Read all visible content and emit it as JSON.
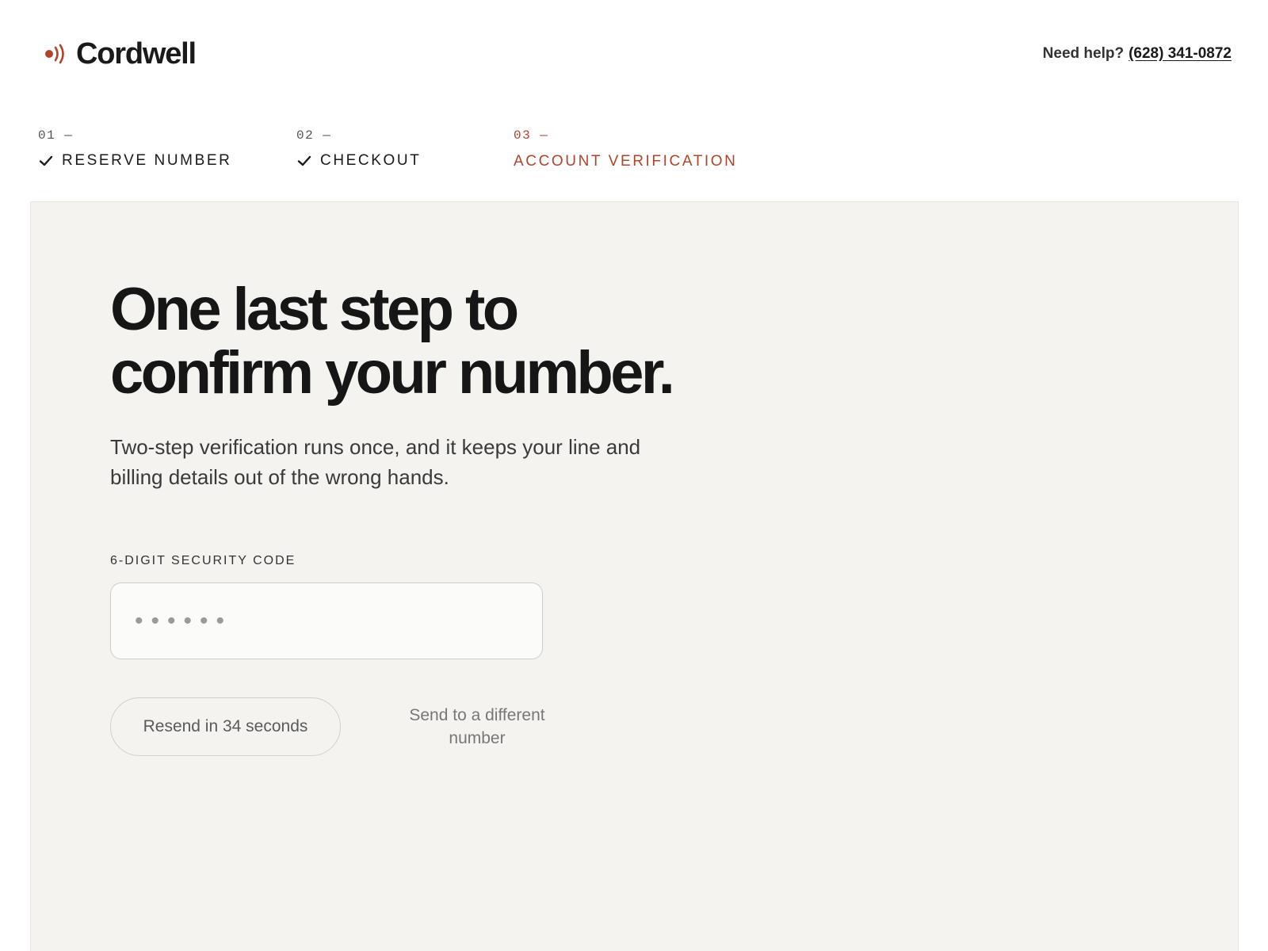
{
  "brand": {
    "name": "Cordwell",
    "logo_icon": "sound-waves-icon",
    "accent_color": "#b0442a"
  },
  "header": {
    "help_label": "Need help?",
    "help_phone": "(628) 341-0872"
  },
  "steps": [
    {
      "number": "01 —",
      "label": "RESERVE NUMBER",
      "status": "complete",
      "icon": "check-icon"
    },
    {
      "number": "02 —",
      "label": "CHECKOUT",
      "status": "complete",
      "icon": "check-icon"
    },
    {
      "number": "03 —",
      "label": "ACCOUNT VERIFICATION",
      "status": "active"
    }
  ],
  "main": {
    "headline_line1": "One last step to",
    "headline_line2": "confirm your number.",
    "subtitle": "Two-step verification runs once, and it keeps your line and billing details out of the wrong hands.",
    "code_field": {
      "label": "6-DIGIT SECURITY CODE",
      "placeholder": "••••••",
      "value": ""
    },
    "resend_label": "Resend in 34 seconds",
    "alt_link_label": "Send to a different number"
  }
}
